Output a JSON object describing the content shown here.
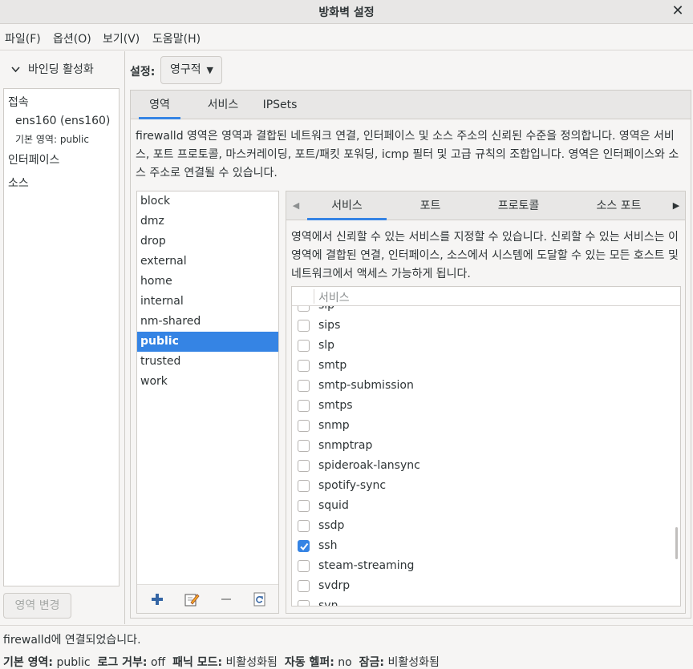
{
  "window": {
    "title": "방화벽 설정",
    "close_glyph": "✕"
  },
  "menu": [
    "파일(F)",
    "옵션(O)",
    "보기(V)",
    "도움말(H)"
  ],
  "sidebar": {
    "binding_label": "바인딩 활성화",
    "connections_heading": "접속",
    "connection_name": "ens160 (ens160)",
    "connection_zone_label": "기본 영역:",
    "connection_zone_value": "public",
    "interfaces_heading": "인터페이스",
    "sources_heading": "소스",
    "change_zone_button": "영역 변경"
  },
  "config": {
    "label": "설정:",
    "value": "영구적"
  },
  "tabs": [
    "영역",
    "서비스",
    "IPSets"
  ],
  "zone_description": "firewalld 영역은 영역과 결합된 네트워크 연결, 인터페이스 및 소스 주소의 신뢰된 수준을 정의합니다. 영역은 서비스, 포트 프로토콜, 마스커레이딩, 포트/패킷 포워딩, icmp 필터 및 고급 규칙의 조합입니다. 영역은 인터페이스와 소스 주소로 연결될 수 있습니다.",
  "zones": [
    "block",
    "dmz",
    "drop",
    "external",
    "home",
    "internal",
    "nm-shared",
    "public",
    "trusted",
    "work"
  ],
  "selected_zone": "public",
  "zone_tools": [
    "add-icon",
    "edit-icon",
    "remove-icon",
    "reload-icon"
  ],
  "inner_tabs": [
    "서비스",
    "포트",
    "프로토콜",
    "소스 포트"
  ],
  "services_description": "영역에서 신뢰할 수 있는 서비스를 지정할 수 있습니다. 신뢰할 수 있는 서비스는 이 영역에 결합된 연결, 인터페이스, 소스에서 시스템에 도달할 수 있는 모든 호스트 및 네트워크에서 액세스 가능하게 됩니다.",
  "services_header": "서비스",
  "services": [
    {
      "name": "sip",
      "checked": false
    },
    {
      "name": "sips",
      "checked": false
    },
    {
      "name": "slp",
      "checked": false
    },
    {
      "name": "smtp",
      "checked": false
    },
    {
      "name": "smtp-submission",
      "checked": false
    },
    {
      "name": "smtps",
      "checked": false
    },
    {
      "name": "snmp",
      "checked": false
    },
    {
      "name": "snmptrap",
      "checked": false
    },
    {
      "name": "spideroak-lansync",
      "checked": false
    },
    {
      "name": "spotify-sync",
      "checked": false
    },
    {
      "name": "squid",
      "checked": false
    },
    {
      "name": "ssdp",
      "checked": false
    },
    {
      "name": "ssh",
      "checked": true
    },
    {
      "name": "steam-streaming",
      "checked": false
    },
    {
      "name": "svdrp",
      "checked": false
    },
    {
      "name": "svn",
      "checked": false
    }
  ],
  "status": {
    "message": "firewalld에 연결되었습니다.",
    "default_zone_label": "기본 영역:",
    "default_zone": "public",
    "log_denied_label": "로그 거부:",
    "log_denied": "off",
    "panic_label": "패닉 모드:",
    "panic": "비활성화됨",
    "helper_label": "자동 헬퍼:",
    "helper": "no",
    "lockdown_label": "잠금:",
    "lockdown": "비활성화됨"
  },
  "colors": {
    "accent": "#3584e4"
  }
}
